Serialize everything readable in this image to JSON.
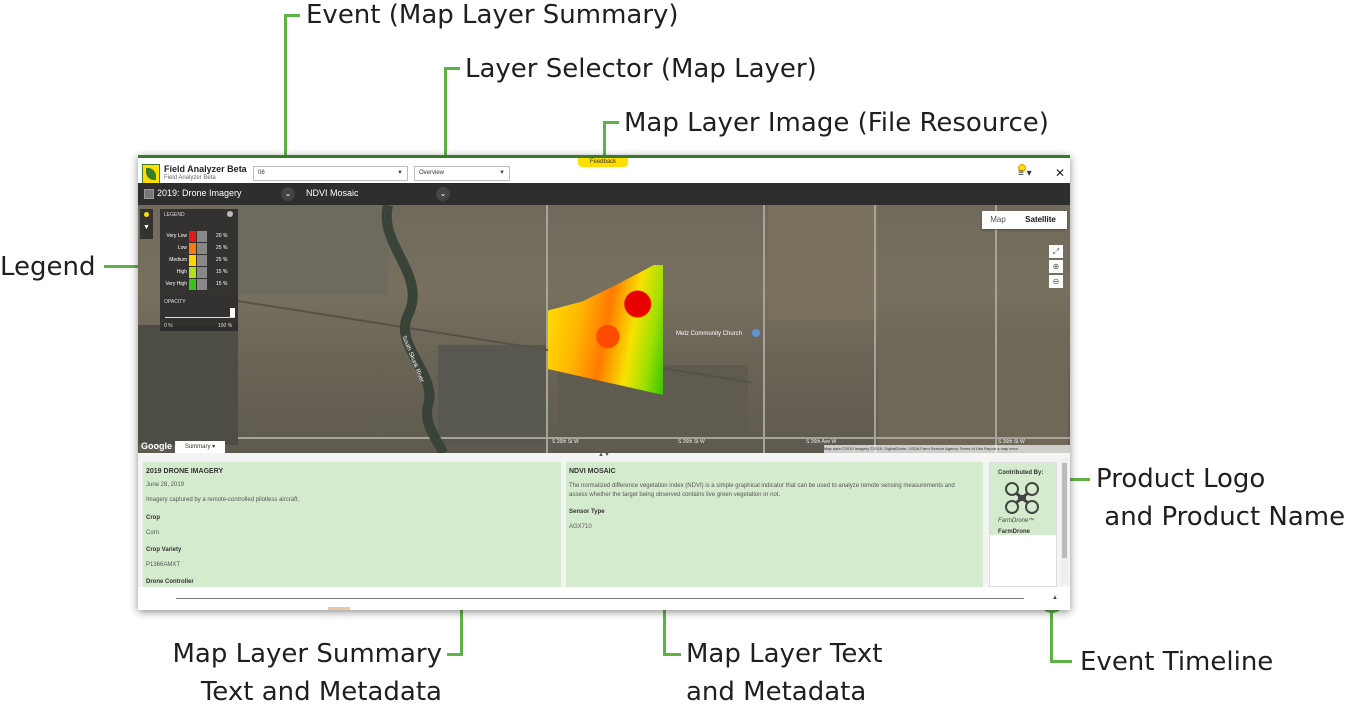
{
  "annotations": {
    "event": "Event (Map Layer Summary)",
    "layer_selector": "Layer Selector (Map Layer)",
    "map_layer_image": "Map Layer Image (File Resource)",
    "legend": "Legend",
    "product_logo": "Product Logo\n and Product Name",
    "summary_text": "Map Layer Summary\nText and Metadata",
    "layer_text": "Map Layer Text\nand Metadata",
    "event_timeline": "Event Timeline"
  },
  "header": {
    "feedback": "Feedback",
    "app_title": "Field Analyzer Beta",
    "app_subtitle": "Field Analyzer Beta",
    "field_select": "06",
    "view_select": "Overview",
    "menu_icon": "≡ ▾",
    "close": "✕"
  },
  "layer_bar": {
    "event_name": "2019: Drone Imagery",
    "map_layer": "NDVI Mosaic"
  },
  "map": {
    "type_map": "Map",
    "type_satellite": "Satellite",
    "church": "Metz Community Church",
    "river": "South Skunk River",
    "google": "Google",
    "summary_tab": "Summary ▾",
    "attribution": "Map data ©2019 Imagery ©2019, DigitalGlobe, USDA Farm Service Agency  Terms of Use  Report a map error",
    "road_labels": [
      "S 26th St W",
      "S 26th St W",
      "S 26th Ave W",
      "S 36th St W"
    ]
  },
  "legend": {
    "title": "LEGEND",
    "rows": [
      {
        "label": "Very Low",
        "color": "#e11b1b",
        "pct": "20 %"
      },
      {
        "label": "Low",
        "color": "#f57d0f",
        "pct": "25 %"
      },
      {
        "label": "Medium",
        "color": "#ffd500",
        "pct": "25 %"
      },
      {
        "label": "High",
        "color": "#b5de1c",
        "pct": "15 %"
      },
      {
        "label": "Very High",
        "color": "#39c21a",
        "pct": "15 %"
      }
    ],
    "opacity_label": "OPACITY",
    "opacity_min": "0 %",
    "opacity_max": "100 %",
    "opacity_value": 1.0
  },
  "summary_panel": {
    "title": "2019 DRONE IMAGERY",
    "date": "June 28, 2019",
    "description": "Imagery captured by a remote-controlled pilotless aircraft.",
    "crop_label": "Crop",
    "crop_value": "Corn",
    "variety_label": "Crop Variety",
    "variety_value": "P1366AMXT",
    "controller_label": "Drone Controller"
  },
  "layer_panel": {
    "title": "NDVI MOSAIC",
    "description": "The normalized difference vegetation index (NDVI) is a simple graphical indicator that can be used to analyze remote sensing measurements and assess whether the target being observed contains live green vegetation or not.",
    "sensor_label": "Sensor Type",
    "sensor_value": "AGX710"
  },
  "product_panel": {
    "contributed_by": "Contributed By:",
    "brand": "FarmDrone™",
    "name": "FarmDrone"
  },
  "timeline": {
    "toggle": "▲"
  },
  "colors": {
    "accent_green": "#5fb246",
    "jd_green": "#367c2b",
    "jd_yellow": "#ffde00",
    "panel_green": "#d5ebce"
  }
}
